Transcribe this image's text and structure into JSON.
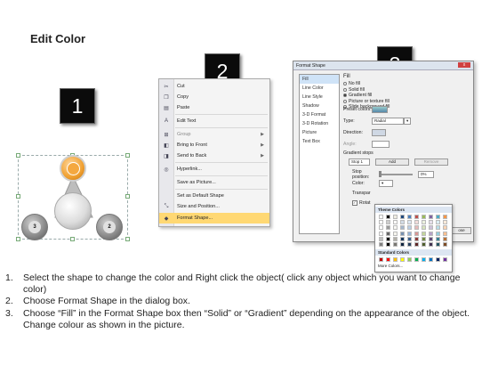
{
  "title": "Edit Color",
  "step_badges": [
    "1",
    "2",
    "3"
  ],
  "shape_labels": [
    "3",
    "2"
  ],
  "context_menu": {
    "items": [
      "Cut",
      "Copy",
      "Paste",
      "Edit Text",
      "Group",
      "Bring to Front",
      "Send to Back",
      "Hyperlink...",
      "Save as Picture...",
      "Set as Default Shape",
      "Size and Position...",
      "Format Shape..."
    ],
    "highlighted": "Format Shape..."
  },
  "dialog": {
    "title": "Format Shape",
    "close_label": "x",
    "categories": [
      "Fill",
      "Line Color",
      "Line Style",
      "Shadow",
      "3-D Format",
      "3-D Rotation",
      "Picture",
      "Text Box"
    ],
    "selected_category": "Fill",
    "section_title": "Fill",
    "fill_options": [
      "No fill",
      "Solid fill",
      "Gradient fill",
      "Picture or texture fill",
      "Slide background fill"
    ],
    "selected_fill": "Gradient fill",
    "preset_colors_label": "Preset colors:",
    "type_label": "Type:",
    "type_value": "Radial",
    "direction_label": "Direction:",
    "angle_label": "Angle:",
    "gradient_stops_label": "Gradient stops",
    "stop_value": "Stop 1",
    "add_label": "Add",
    "remove_label": "Remove",
    "stop_position_label": "Stop position:",
    "stop_position_value": "0%",
    "color_label": "Color:",
    "transparency_label": "Transpar",
    "rotate_label": "Rotat",
    "close_button": "ose"
  },
  "palette": {
    "theme_header": "Theme Colors",
    "standard_header": "Standard Colors",
    "more_label": "More Colors..."
  },
  "instructions": [
    {
      "num": "1.",
      "text": "Select the shape to change the color and Right click the object( click any object which you want to change color)"
    },
    {
      "num": "2.",
      "text": "Choose Format Shape in the dialog box."
    },
    {
      "num": "3.",
      "text": "Choose “Fill” in the Format Shape box then “Solid” or “Gradient” depending on the appearance of the object. Change colour as shown in the picture."
    }
  ],
  "colors": {
    "accent_orange": "#f0a030",
    "highlight": "#ffd873",
    "badge_bg": "#0b0b0b"
  }
}
